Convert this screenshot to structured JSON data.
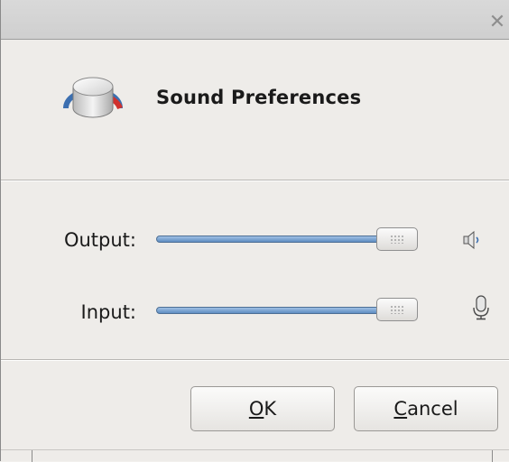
{
  "window": {
    "title": "Sound Preferences",
    "close_icon": "close-icon"
  },
  "rows": {
    "output": {
      "label": "Output:",
      "level": 1.0,
      "icon": "speaker-icon"
    },
    "input": {
      "label": "Input:",
      "level": 1.0,
      "icon": "microphone-icon"
    }
  },
  "buttons": {
    "ok": {
      "mnemonic": "O",
      "rest": "K"
    },
    "cancel": {
      "mnemonic": "C",
      "rest": "ancel"
    }
  },
  "colors": {
    "slider_fill": "#5e8dc2",
    "accent_red": "#d0312d"
  }
}
